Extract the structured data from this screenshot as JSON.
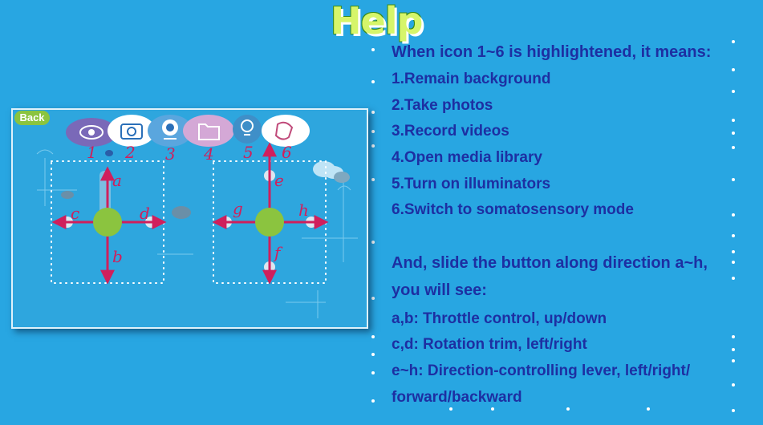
{
  "header": {
    "title": "Help"
  },
  "diagram": {
    "back_label": "Back",
    "icons": [
      {
        "name": "eye-icon",
        "number": "1",
        "color": "#7a69b8"
      },
      {
        "name": "camera-icon",
        "number": "2",
        "color": "#ffffff"
      },
      {
        "name": "webcam-icon",
        "number": "3",
        "color": "#5aa6de"
      },
      {
        "name": "folder-icon",
        "number": "4",
        "color": "#d4a8d6"
      },
      {
        "name": "lightbulb-icon",
        "number": "5",
        "color": "#3f8fc8"
      },
      {
        "name": "gamepad-icon",
        "number": "6",
        "color": "#ffffff"
      }
    ],
    "direction_labels": [
      "a",
      "b",
      "c",
      "d",
      "e",
      "f",
      "g",
      "h"
    ],
    "arrow_color": "#d01f5c",
    "knob_color": "#8bc43f"
  },
  "help": {
    "intro": "When icon 1~6 is highlightened, it means:",
    "items": [
      "1.Remain background",
      "2.Take photos",
      "3.Record videos",
      "4.Open media library",
      "5.Turn on illuminators",
      "6.Switch to somatosensory mode"
    ],
    "slide_line1": "And, slide the button along direction a~h,",
    "slide_line2": "you will see:",
    "controls": [
      "a,b: Throttle control, up/down",
      "c,d: Rotation trim, left/right",
      "e~h: Direction-controlling lever, left/right/",
      "forward/backward"
    ]
  }
}
